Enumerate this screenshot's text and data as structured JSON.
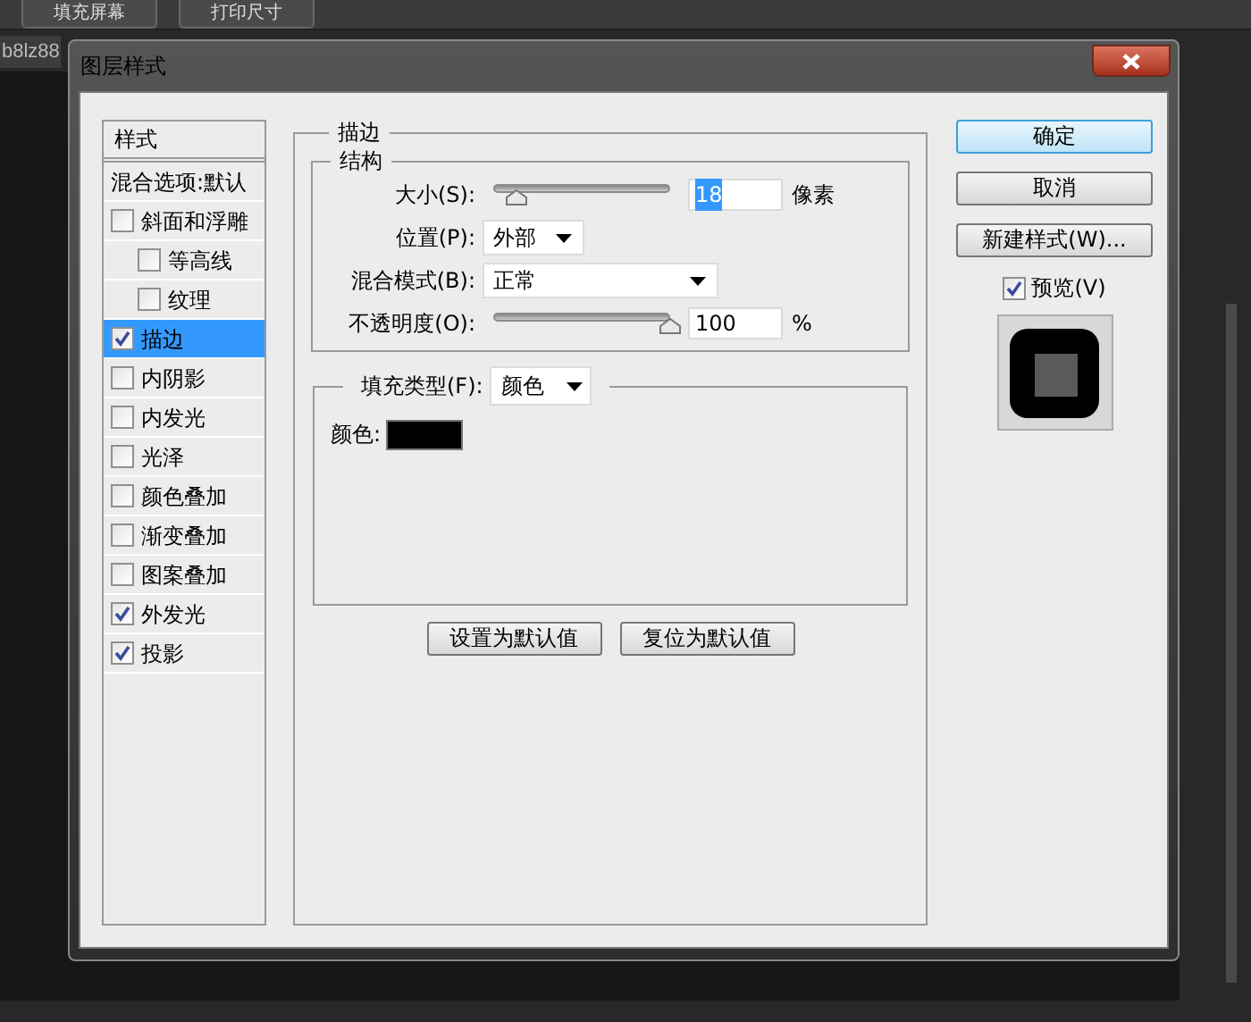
{
  "app": {
    "toolbar_buttons": [
      "填充屏幕",
      "打印尺寸"
    ],
    "document_tab": "b8lz88"
  },
  "dialog": {
    "title": "图层样式",
    "styles_list": {
      "header": "样式",
      "items": [
        {
          "kind": "option",
          "label": "混合选项:默认",
          "selected": false
        },
        {
          "kind": "effect",
          "label": "斜面和浮雕",
          "checked": false,
          "selected": false,
          "children": [
            {
              "kind": "effect",
              "label": "等高线",
              "checked": false,
              "selected": false
            },
            {
              "kind": "effect",
              "label": "纹理",
              "checked": false,
              "selected": false
            }
          ]
        },
        {
          "kind": "effect",
          "label": "描边",
          "checked": true,
          "selected": true
        },
        {
          "kind": "effect",
          "label": "内阴影",
          "checked": false,
          "selected": false
        },
        {
          "kind": "effect",
          "label": "内发光",
          "checked": false,
          "selected": false
        },
        {
          "kind": "effect",
          "label": "光泽",
          "checked": false,
          "selected": false
        },
        {
          "kind": "effect",
          "label": "颜色叠加",
          "checked": false,
          "selected": false
        },
        {
          "kind": "effect",
          "label": "渐变叠加",
          "checked": false,
          "selected": false
        },
        {
          "kind": "effect",
          "label": "图案叠加",
          "checked": false,
          "selected": false
        },
        {
          "kind": "effect",
          "label": "外发光",
          "checked": true,
          "selected": false
        },
        {
          "kind": "effect",
          "label": "投影",
          "checked": true,
          "selected": false
        }
      ]
    },
    "stroke": {
      "title": "描边",
      "structure": {
        "title": "结构",
        "rows": [
          {
            "kind": "slider",
            "label": "大小(S):",
            "level": 0.13,
            "value": "18",
            "value_selected": true,
            "unit": "像素"
          },
          {
            "kind": "dropdown",
            "label": "位置(P):",
            "value": "外部",
            "wide": false
          },
          {
            "kind": "dropdown",
            "label": "混合模式(B):",
            "value": "正常",
            "wide": true
          },
          {
            "kind": "slider",
            "label": "不透明度(O):",
            "level": 1,
            "value": "100",
            "value_selected": false,
            "unit": "%"
          }
        ]
      },
      "fill": {
        "label": "填充类型(F):",
        "value": "颜色",
        "color_label": "颜色:",
        "color": "#000000"
      }
    },
    "bottom_buttons": [
      "设置为默认值",
      "复位为默认值"
    ],
    "side_buttons": [
      {
        "label": "确定",
        "default": true
      },
      {
        "label": "取消",
        "default": false
      },
      {
        "label": "新建样式(W)...",
        "default": false
      }
    ],
    "preview": {
      "label": "预览(V)",
      "checked": true
    }
  }
}
